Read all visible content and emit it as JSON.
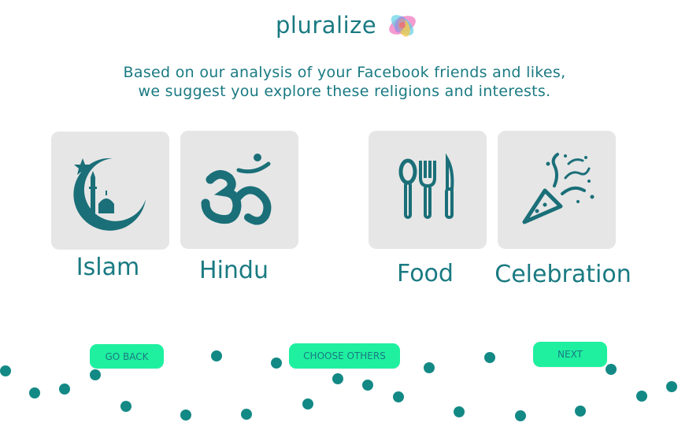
{
  "brand": {
    "name": "pluralize",
    "logo": "pluralize-swirl-logo"
  },
  "intro": {
    "line1": "Based on our analysis of your Facebook friends and likes,",
    "line2": "we suggest you explore these religions and interests."
  },
  "suggestions": [
    {
      "label": "Islam",
      "icon": "crescent-mosque-icon"
    },
    {
      "label": "Hindu",
      "icon": "om-icon"
    },
    {
      "label": "Food",
      "icon": "cutlery-icon"
    },
    {
      "label": "Celebration",
      "icon": "party-popper-icon"
    }
  ],
  "buttons": {
    "back": "GO BACK",
    "choose_others": "CHOOSE OTHERS",
    "next": "NEXT"
  },
  "colors": {
    "accent": "#1a7a82",
    "button": "#1ff0a0",
    "card": "#e6e6e6",
    "dots": "#138985"
  }
}
